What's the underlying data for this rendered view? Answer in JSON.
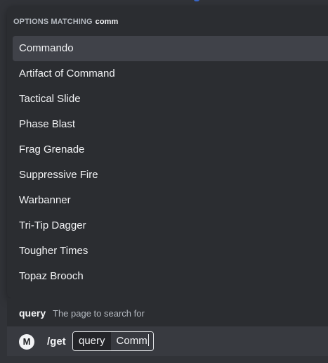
{
  "autocomplete": {
    "header_label": "OPTIONS MATCHING",
    "header_query": "comm",
    "options": [
      {
        "label": "Commando",
        "selected": true
      },
      {
        "label": "Artifact of Command",
        "selected": false
      },
      {
        "label": "Tactical Slide",
        "selected": false
      },
      {
        "label": "Phase Blast",
        "selected": false
      },
      {
        "label": "Frag Grenade",
        "selected": false
      },
      {
        "label": "Suppressive Fire",
        "selected": false
      },
      {
        "label": "Warbanner",
        "selected": false
      },
      {
        "label": "Tri-Tip Dagger",
        "selected": false
      },
      {
        "label": "Tougher Times",
        "selected": false
      },
      {
        "label": "Topaz Brooch",
        "selected": false
      }
    ]
  },
  "param_hint": {
    "name": "query",
    "description": "The page to search for"
  },
  "command_input": {
    "app_icon": "M",
    "command": "/get",
    "param_label": "query",
    "param_value": "Comm"
  },
  "colors": {
    "background": "#313338",
    "popup": "#2b2d31",
    "selected_option": "#404249",
    "input_bar": "#383a40",
    "text": "#f2f3f5",
    "muted_text": "#b5bac1"
  }
}
